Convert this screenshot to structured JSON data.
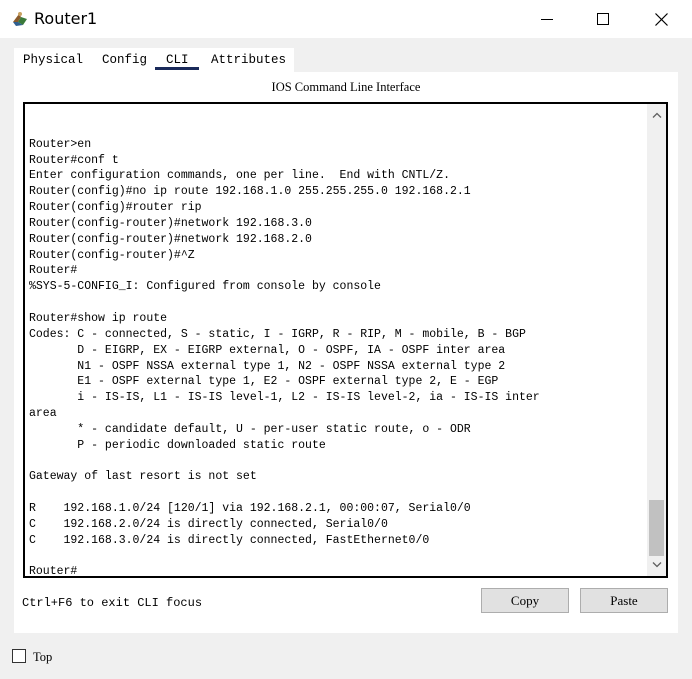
{
  "window": {
    "title": "Router1",
    "icon": "router-app-icon",
    "controls": [
      "minimize-icon",
      "maximize-icon",
      "close-icon"
    ]
  },
  "tabs": [
    {
      "label": "Physical",
      "active": false
    },
    {
      "label": "Config",
      "active": false
    },
    {
      "label": "CLI",
      "active": true
    },
    {
      "label": "Attributes",
      "active": false
    }
  ],
  "panel": {
    "title": "IOS Command Line Interface"
  },
  "terminal": {
    "lines": [
      "",
      "",
      "Router>en",
      "Router#conf t",
      "Enter configuration commands, one per line.  End with CNTL/Z.",
      "Router(config)#no ip route 192.168.1.0 255.255.255.0 192.168.2.1",
      "Router(config)#router rip",
      "Router(config-router)#network 192.168.3.0",
      "Router(config-router)#network 192.168.2.0",
      "Router(config-router)#^Z",
      "Router#",
      "%SYS-5-CONFIG_I: Configured from console by console",
      "",
      "Router#show ip route",
      "Codes: C - connected, S - static, I - IGRP, R - RIP, M - mobile, B - BGP",
      "       D - EIGRP, EX - EIGRP external, O - OSPF, IA - OSPF inter area",
      "       N1 - OSPF NSSA external type 1, N2 - OSPF NSSA external type 2",
      "       E1 - OSPF external type 1, E2 - OSPF external type 2, E - EGP",
      "       i - IS-IS, L1 - IS-IS level-1, L2 - IS-IS level-2, ia - IS-IS inter",
      "area",
      "       * - candidate default, U - per-user static route, o - ODR",
      "       P - periodic downloaded static route",
      "",
      "Gateway of last resort is not set",
      "",
      "R    192.168.1.0/24 [120/1] via 192.168.2.1, 00:00:07, Serial0/0",
      "C    192.168.2.0/24 is directly connected, Serial0/0",
      "C    192.168.3.0/24 is directly connected, FastEthernet0/0",
      "",
      "Router#"
    ]
  },
  "footer": {
    "hint": "Ctrl+F6 to exit CLI focus",
    "copy_label": "Copy",
    "paste_label": "Paste"
  },
  "top_checkbox": {
    "label": "Top",
    "checked": false
  }
}
